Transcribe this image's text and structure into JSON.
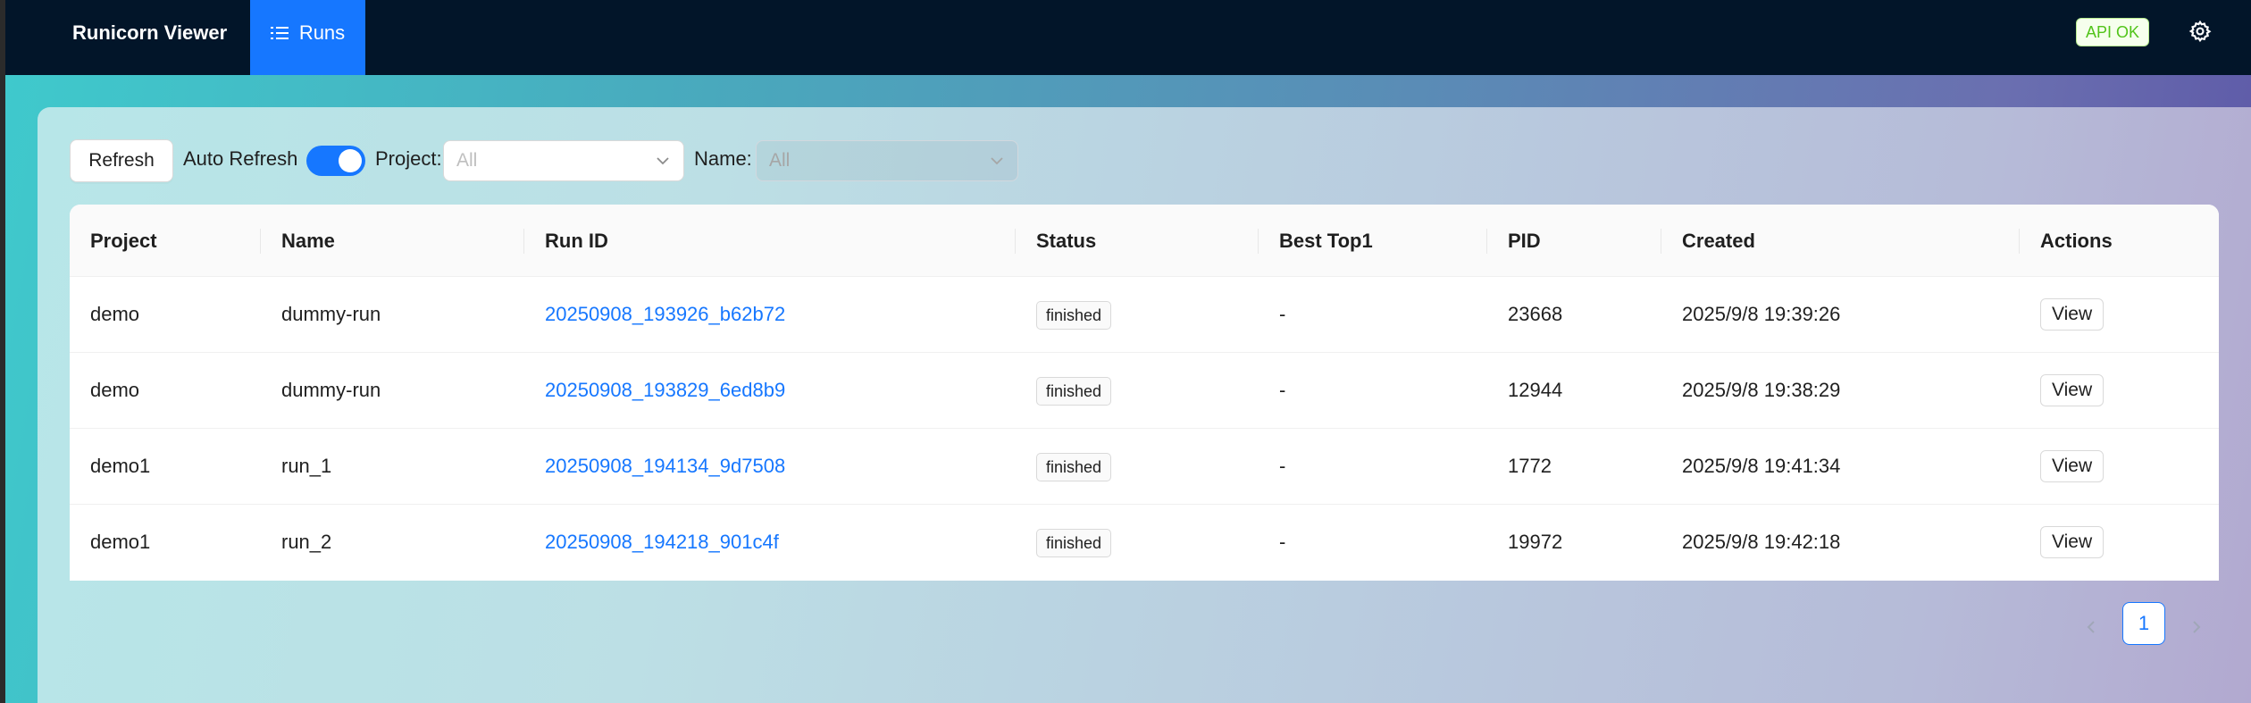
{
  "app": {
    "brand": "Runicorn Viewer",
    "nav_runs_label": "Runs",
    "api_status": "API OK",
    "accent_color": "#1677ff",
    "header_bg": "#021529"
  },
  "toolbar": {
    "refresh_label": "Refresh",
    "auto_refresh_label": "Auto Refresh",
    "auto_refresh_on": true,
    "project_label": "Project:",
    "project_placeholder": "All",
    "name_label": "Name:",
    "name_placeholder": "All"
  },
  "table": {
    "columns": [
      "Project",
      "Name",
      "Run ID",
      "Status",
      "Best Top1",
      "PID",
      "Created",
      "Actions"
    ],
    "rows": [
      {
        "project": "demo",
        "name": "dummy-run",
        "run_id": "20250908_193926_b62b72",
        "status": "finished",
        "best_top1": "-",
        "pid": "23668",
        "created": "2025/9/8 19:39:26",
        "action": "View"
      },
      {
        "project": "demo",
        "name": "dummy-run",
        "run_id": "20250908_193829_6ed8b9",
        "status": "finished",
        "best_top1": "-",
        "pid": "12944",
        "created": "2025/9/8 19:38:29",
        "action": "View"
      },
      {
        "project": "demo1",
        "name": "run_1",
        "run_id": "20250908_194134_9d7508",
        "status": "finished",
        "best_top1": "-",
        "pid": "1772",
        "created": "2025/9/8 19:41:34",
        "action": "View"
      },
      {
        "project": "demo1",
        "name": "run_2",
        "run_id": "20250908_194218_901c4f",
        "status": "finished",
        "best_top1": "-",
        "pid": "19972",
        "created": "2025/9/8 19:42:18",
        "action": "View"
      }
    ]
  },
  "pagination": {
    "current_page": "1"
  },
  "icons": {
    "runs": "list-icon",
    "settings": "gear-icon",
    "prev": "chevron-left-icon",
    "next": "chevron-right-icon",
    "dropdown": "chevron-down-icon"
  }
}
